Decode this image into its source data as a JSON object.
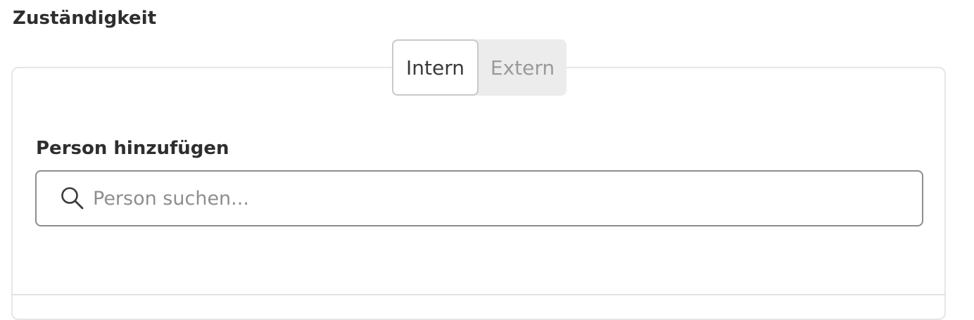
{
  "section": {
    "title": "Zuständigkeit"
  },
  "toggle": {
    "options": [
      {
        "label": "Intern",
        "selected": true
      },
      {
        "label": "Extern",
        "selected": false
      }
    ]
  },
  "person": {
    "label": "Person hinzufügen",
    "search": {
      "icon": "search-icon",
      "placeholder": "Person suchen...",
      "value": ""
    }
  },
  "colors": {
    "text": "#2e2e2e",
    "border_light": "#e6e6e6",
    "input_border": "#8d8d8d",
    "toggle_bg": "#ececec",
    "inactive_text": "#9a9a9a"
  }
}
